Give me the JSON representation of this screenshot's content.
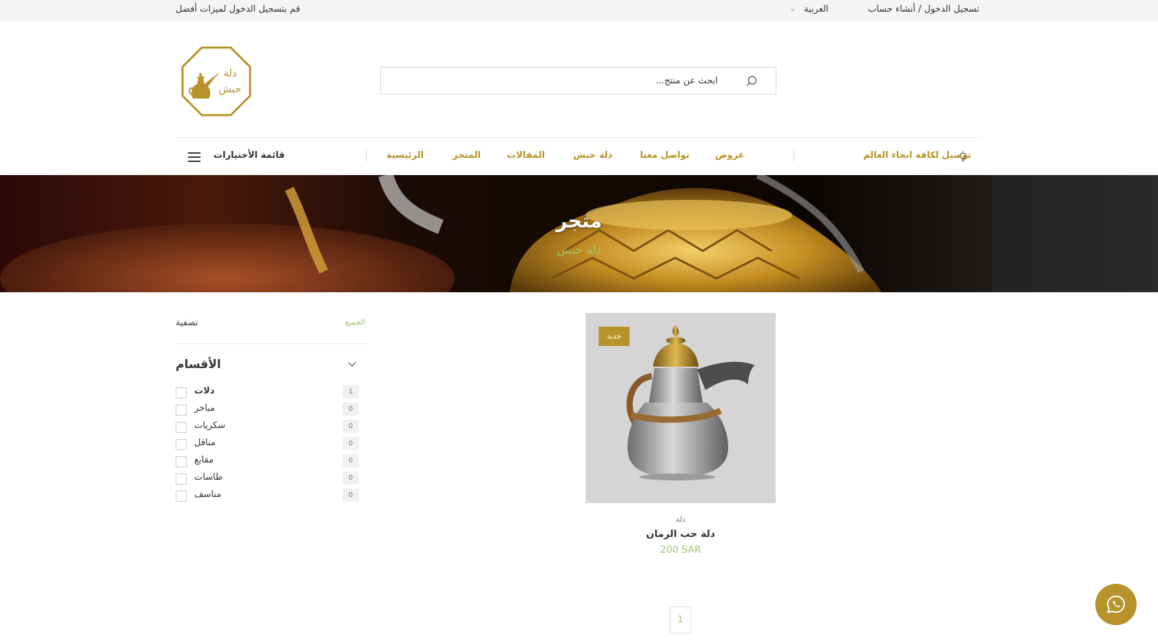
{
  "topbar": {
    "login_link": "تسجيل الدخول / أنشاء حساب",
    "language": "العربية",
    "promo": "قم بتسجيل الدخول لميزات أفضل"
  },
  "logo": {
    "line1": "دلة",
    "line2": "حبش",
    "color": "#b8922a"
  },
  "search": {
    "placeholder": "ابحث عن منتج..."
  },
  "nav": {
    "shipping": "توصيل لكافة انحاء العالم",
    "items": [
      {
        "label": "عروض"
      },
      {
        "label": "تواصل معنا"
      },
      {
        "label": "دلة حبش"
      },
      {
        "label": "المقالات"
      },
      {
        "label": "المتجر"
      },
      {
        "label": "الرئيسية"
      }
    ],
    "menu_label": "قائمة الأختيارات",
    "accent_color": "#b8922a"
  },
  "hero": {
    "title": "متجر",
    "subtitle": "دلة حبش"
  },
  "sidebar": {
    "filter_label": "تصفية",
    "all_label": "الجميع",
    "categories_title": "الأقسام",
    "categories": [
      {
        "name": "دلات",
        "count": "1"
      },
      {
        "name": "مباخر",
        "count": "0"
      },
      {
        "name": "سكريات",
        "count": "0"
      },
      {
        "name": "مناقل",
        "count": "0"
      },
      {
        "name": "مقابع",
        "count": "0"
      },
      {
        "name": "طاسات",
        "count": "0"
      },
      {
        "name": "مناسف",
        "count": "0"
      }
    ]
  },
  "products": [
    {
      "badge": "جديد",
      "category": "دلة",
      "name": "دلة حب الرمان",
      "price": "200 SAR"
    }
  ],
  "pagination": {
    "current": "1"
  },
  "whatsapp": {
    "icon": "whatsapp-icon"
  },
  "colors": {
    "gold": "#b8922a",
    "green": "#9fc46a"
  }
}
